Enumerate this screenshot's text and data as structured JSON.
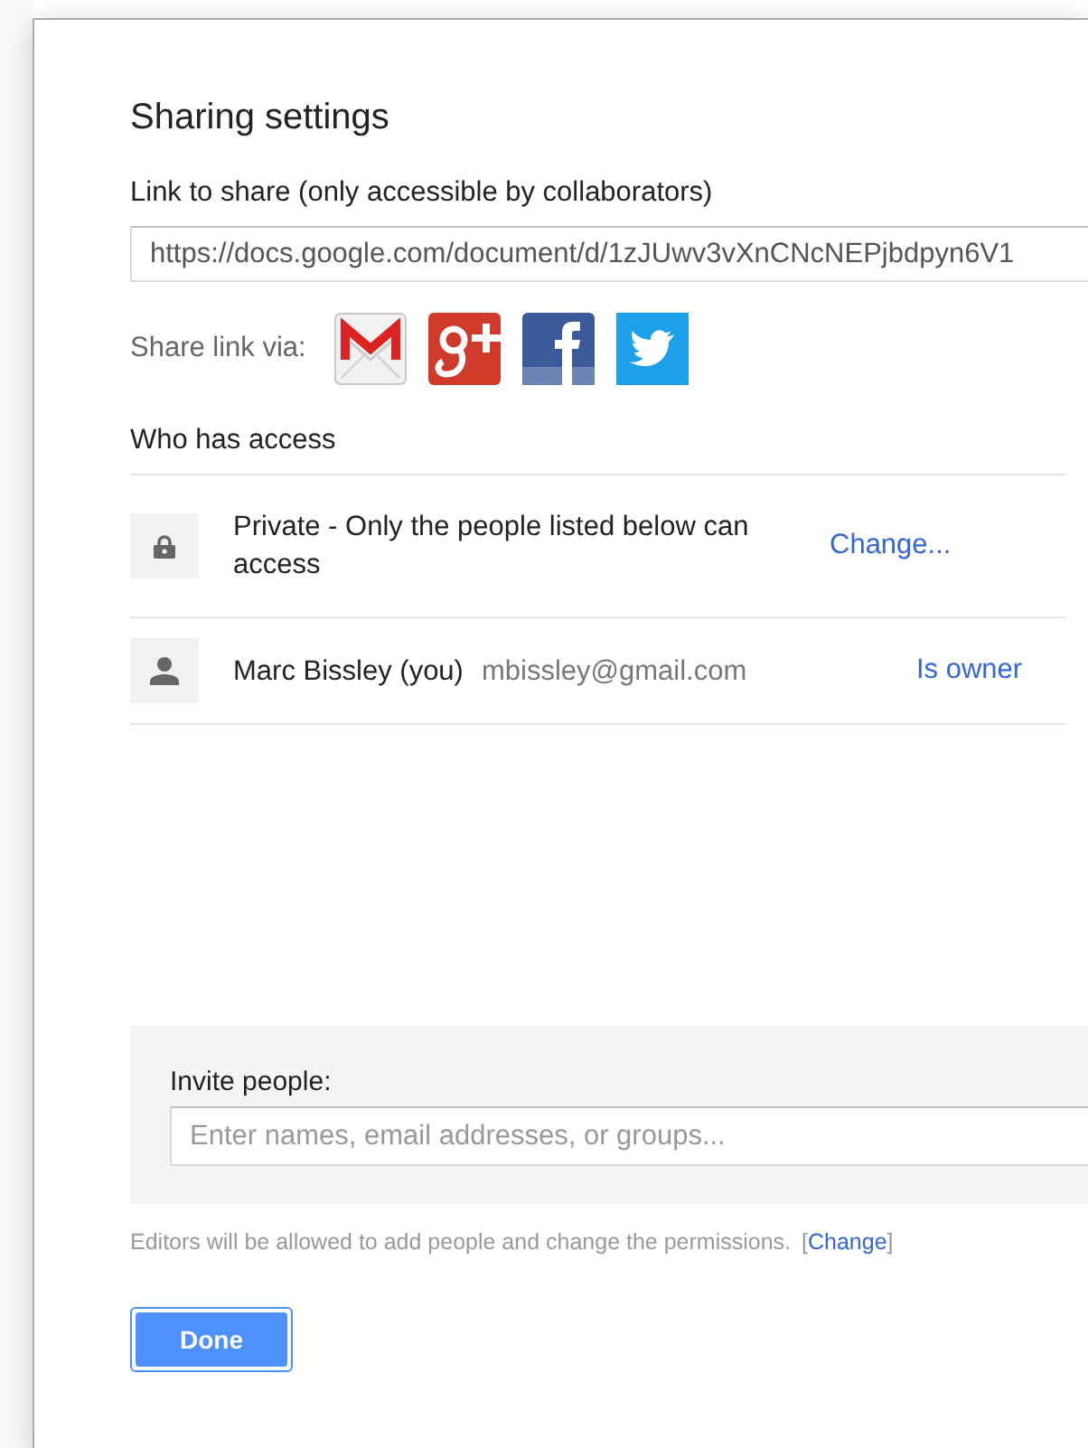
{
  "dialog": {
    "title": "Sharing settings",
    "link_label": "Link to share (only accessible by collaborators)",
    "link_value": "https://docs.google.com/document/d/1zJUwv3vXnCNcNEPjbdpyn6V1",
    "share_via_label": "Share link via:",
    "share_services": [
      {
        "kind": "gmail"
      },
      {
        "kind": "googleplus"
      },
      {
        "kind": "facebook"
      },
      {
        "kind": "twitter"
      }
    ],
    "access_heading": "Who has access",
    "access_rows": [
      {
        "kind": "visibility",
        "text": "Private - Only the people listed below can access",
        "action": "Change..."
      },
      {
        "kind": "person",
        "name": "Marc Bissley (you)",
        "email": "mbissley@gmail.com",
        "role": "Is owner"
      }
    ],
    "invite_label": "Invite people:",
    "invite_placeholder": "Enter names, email addresses, or groups...",
    "footnote": "Editors will be allowed to add people and change the permissions.",
    "footnote_open": "[",
    "footnote_link": "Change",
    "footnote_close": "]",
    "done_button": "Done"
  }
}
